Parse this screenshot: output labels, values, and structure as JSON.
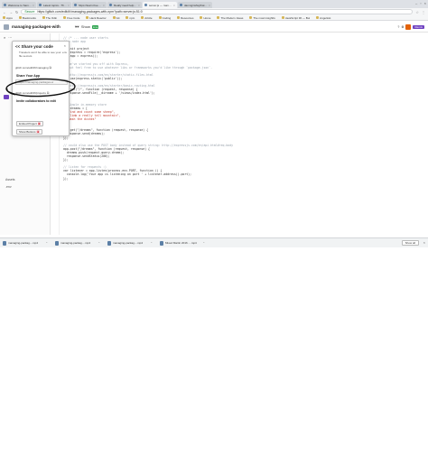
{
  "browser": {
    "tabs": [
      {
        "label": "Welcome to Sam Kea | Kn",
        "active": false
      },
      {
        "label": "Latest topics - The Fre",
        "active": false
      },
      {
        "label": "https://learn.freecode",
        "active": false
      },
      {
        "label": "Really need help with n",
        "active": false
      },
      {
        "label": "server.js — managing-p",
        "active": true
      },
      {
        "label": "damnginsfwythat.md |",
        "active": false
      }
    ],
    "secure_label": "Secure",
    "url": "https://glitch.com/edit/#!/managing-packages-with-npm?path=server.js:51:0",
    "bookmarks": [
      "Apps",
      "Bookmarks",
      "The Odin",
      "Free Code",
      "Hack Reactor",
      "Git",
      "npm",
      "Article",
      "Coding",
      "Resources",
      "Home",
      "The Modern Javas",
      "The most insightfu",
      "JavaScript 30 — Bui",
      "AngelList"
    ]
  },
  "glitch": {
    "project_name": "managing-packages-with",
    "show_label": "Show",
    "live_badge": "Live",
    "header_buttons": [
      "?",
      "⚙"
    ],
    "pill": "Remix"
  },
  "sidebar": {
    "search_icon": "search-icon",
    "items": [
      "⋯",
      "Share",
      "Assets",
      ".env"
    ]
  },
  "share_popover": {
    "title": "<< Share your code",
    "note": "Travelers won't be able to see your .env file secrets",
    "code_url": "glitch.com/edit/#!/managing",
    "app_section": "Share Your App",
    "embed_placeholder": "https://managing-packages-w",
    "live_url": "glitch.com/edit/#!/projects",
    "invite_section": "Invite collaborators to edit",
    "embed_button": "Embed Project",
    "show_button": "Show Buttons"
  },
  "annotation": {
    "color": "#111111"
  },
  "editor": {
    "lines": [
      {
        "t": "c",
        "s": "// /* ... node user starts"
      },
      {
        "t": "c",
        "s": "// a node app"
      },
      {
        "t": "x",
        "s": ""
      },
      {
        "t": "k",
        "s": "// init project"
      },
      {
        "t": "k",
        "s": "var express = require('express');"
      },
      {
        "t": "k",
        "s": "var app = express();"
      },
      {
        "t": "x",
        "s": ""
      },
      {
        "t": "c",
        "s": "// we've started you off with Express,"
      },
      {
        "t": "c",
        "s": "// but feel free to use whatever libs or frameworks you'd like through `package.json`."
      },
      {
        "t": "x",
        "s": ""
      },
      {
        "t": "c",
        "s": "// http://expressjs.com/en/starter/static-files.html"
      },
      {
        "t": "k",
        "s": "app.use(express.static('public'));"
      },
      {
        "t": "x",
        "s": ""
      },
      {
        "t": "c",
        "s": "// http://expressjs.com/en/starter/basic-routing.html"
      },
      {
        "t": "k",
        "s": "app.get(\"/\", function (request, response) {"
      },
      {
        "t": "k",
        "s": "  response.sendFile(__dirname + '/views/index.html');"
      },
      {
        "t": "k",
        "s": "});"
      },
      {
        "t": "x",
        "s": ""
      },
      {
        "t": "c",
        "s": "// Simple in-memory store"
      },
      {
        "t": "k",
        "s": "var dreams = ["
      },
      {
        "t": "s",
        "s": "  \"Find and count some sheep\","
      },
      {
        "t": "s",
        "s": "  \"Climb a really tall mountain\","
      },
      {
        "t": "s",
        "s": "  \"Wash the dishes\""
      },
      {
        "t": "k",
        "s": "];"
      },
      {
        "t": "x",
        "s": ""
      },
      {
        "t": "k",
        "s": "app.get(\"/dreams\", function (request, response) {"
      },
      {
        "t": "k",
        "s": "  response.send(dreams);"
      },
      {
        "t": "k",
        "s": "});"
      },
      {
        "t": "x",
        "s": ""
      },
      {
        "t": "c",
        "s": "// could also use the POST body instead of query string: http://expressjs.com/en/api.html#req.body"
      },
      {
        "t": "k",
        "s": "app.post(\"/dreams\", function (request, response) {"
      },
      {
        "t": "k",
        "s": "  dreams.push(request.query.dream);"
      },
      {
        "t": "k",
        "s": "  response.sendStatus(200);"
      },
      {
        "t": "k",
        "s": "});"
      },
      {
        "t": "x",
        "s": ""
      },
      {
        "t": "c",
        "s": "// listen for requests :)"
      },
      {
        "t": "k",
        "s": "var listener = app.listen(process.env.PORT, function () {"
      },
      {
        "t": "k",
        "s": "  console.log('Your app is listening on port ' + listener.address().port);"
      },
      {
        "t": "k",
        "s": "});"
      }
    ]
  },
  "downloads": {
    "items": [
      {
        "name": "managing-packag....mp4",
        "kind": "video"
      },
      {
        "name": "managing-packag....mp4",
        "kind": "video"
      },
      {
        "name": "managing-packag....mp4",
        "kind": "video"
      },
      {
        "name": "Mixed Martin 2016 ....mp4",
        "kind": "video"
      }
    ],
    "show_all": "Show all"
  }
}
